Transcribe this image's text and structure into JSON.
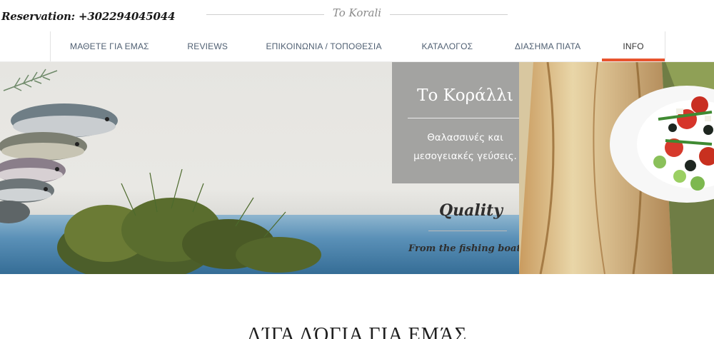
{
  "header": {
    "reservation": "Reservation: +302294045044",
    "brand": "To Korali"
  },
  "nav": {
    "items": [
      {
        "label": "ΜΑΘΕΤΕ ΓΙΑ ΕΜΑΣ"
      },
      {
        "label": "REVIEWS"
      },
      {
        "label": "ΕΠΙΚΟΙΝΩΝΙΑ / ΤΟΠΟΘΕΣΙΑ"
      },
      {
        "label": "ΚΑΤΑΛΟΓΟΣ"
      },
      {
        "label": "ΔΙΑΣΗΜΑ ΠΙΑΤΑ"
      },
      {
        "label": "INFO",
        "active": true
      }
    ]
  },
  "hero": {
    "panel_title": "Το Κοράλλι",
    "panel_subtitle": "Θαλασσινές και μεσογειακές γεύσεις.",
    "quality": "Quality",
    "tagline": "From the fishing boat to"
  },
  "section": {
    "title": "ΛΊΓΑ ΛΌΓΙΑ ΓΙΑ ΕΜΆΣ"
  },
  "colors": {
    "accent": "#e8542e",
    "nav_text": "#4f5f72",
    "panel_bg": "#a3a3a1"
  }
}
